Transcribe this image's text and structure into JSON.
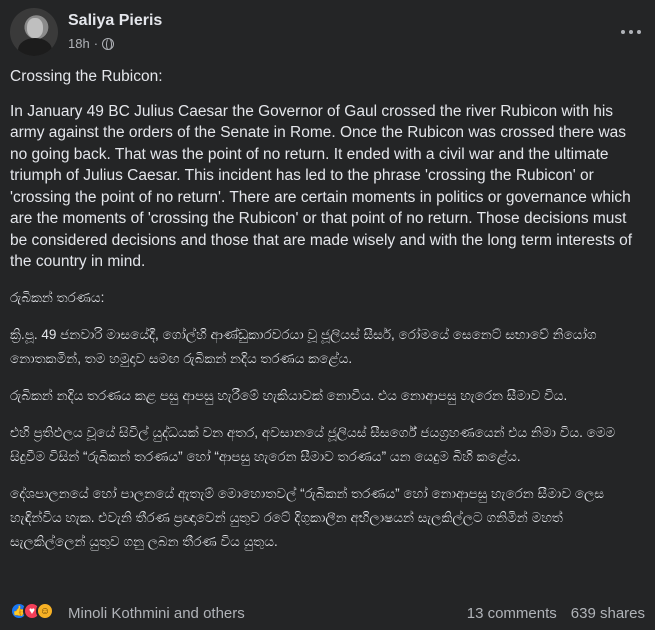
{
  "post": {
    "author": "Saliya Pieris",
    "time": "18h",
    "separator": "·",
    "icons": {
      "privacy": "globe-icon",
      "menu": "more-options-icon"
    },
    "paragraphs": [
      "Crossing the Rubicon:",
      "In January 49 BC Julius Caesar the Governor of Gaul crossed the river Rubicon with his army against the orders of the Senate in Rome. Once the Rubicon was crossed there was no going back. That was the point of no return. It ended with a civil war and the ultimate triumph of Julius Caesar. This incident has led to the phrase 'crossing the Rubicon' or 'crossing the point of no return'. There are certain moments in politics or governance which are the moments of 'crossing the Rubicon' or that point of no return. Those decisions must be considered decisions and those that are made wisely and with the long term interests of the country in mind.",
      "රුබිකන් තරණය:",
      "ක්‍රි.පූ. 49 ජනවාරි මාසයේදී, ගෝල්හි ආණ්ඩුකාරවරයා වූ ජූලියස් සීසර්, රෝමයේ සෙනෙට් සභාවේ නියෝග නොතකමින්, තම හමුදාව සමඟ රුබිකන් නදිය තරණය කළේය.",
      "රුබිකන් නදිය තරණය කළ පසු ආපසු හැරීමේ හැකියාවක් නොවීය. එය නොආපසු හැරෙන සීමාව විය.",
      "එහි ප්‍රතිඵලය වූයේ සිවිල් යුද්ධයක් වන අතර, අවසානයේ ජූලියස් සීසර්ගේ ජයග්‍රහණයෙන් එය නිමා විය. මෙම සිදුවීම විසින් “රුබිකන් තරණය” හෝ “ආපසු හැරෙන සීමාව තරණය” යන යෙදුම බිහි කළේය.",
      "දේශපාලනයේ හෝ පාලනයේ ඇතැම් මොහොතවල් “රුබිකන් තරණය” හෝ නොආපසු හැරෙන සීමාව ලෙස හැඳින්විය හැක. එවැනි තීරණ ප්‍රඥාවෙන් යුතුව රටේ දිගුකාලීන අභිලාෂයන් සැලකිල්ලට ගනිමින් මහත් සැලකිල්ලෙන් යුතුව ගනු ලබන තීරණ විය යුතුය."
    ],
    "reactions": {
      "icons": [
        "like-icon",
        "love-icon",
        "care-icon"
      ],
      "reactors": "Minoli Kothmini and others",
      "comments": "13 comments",
      "shares": "639 shares"
    }
  }
}
